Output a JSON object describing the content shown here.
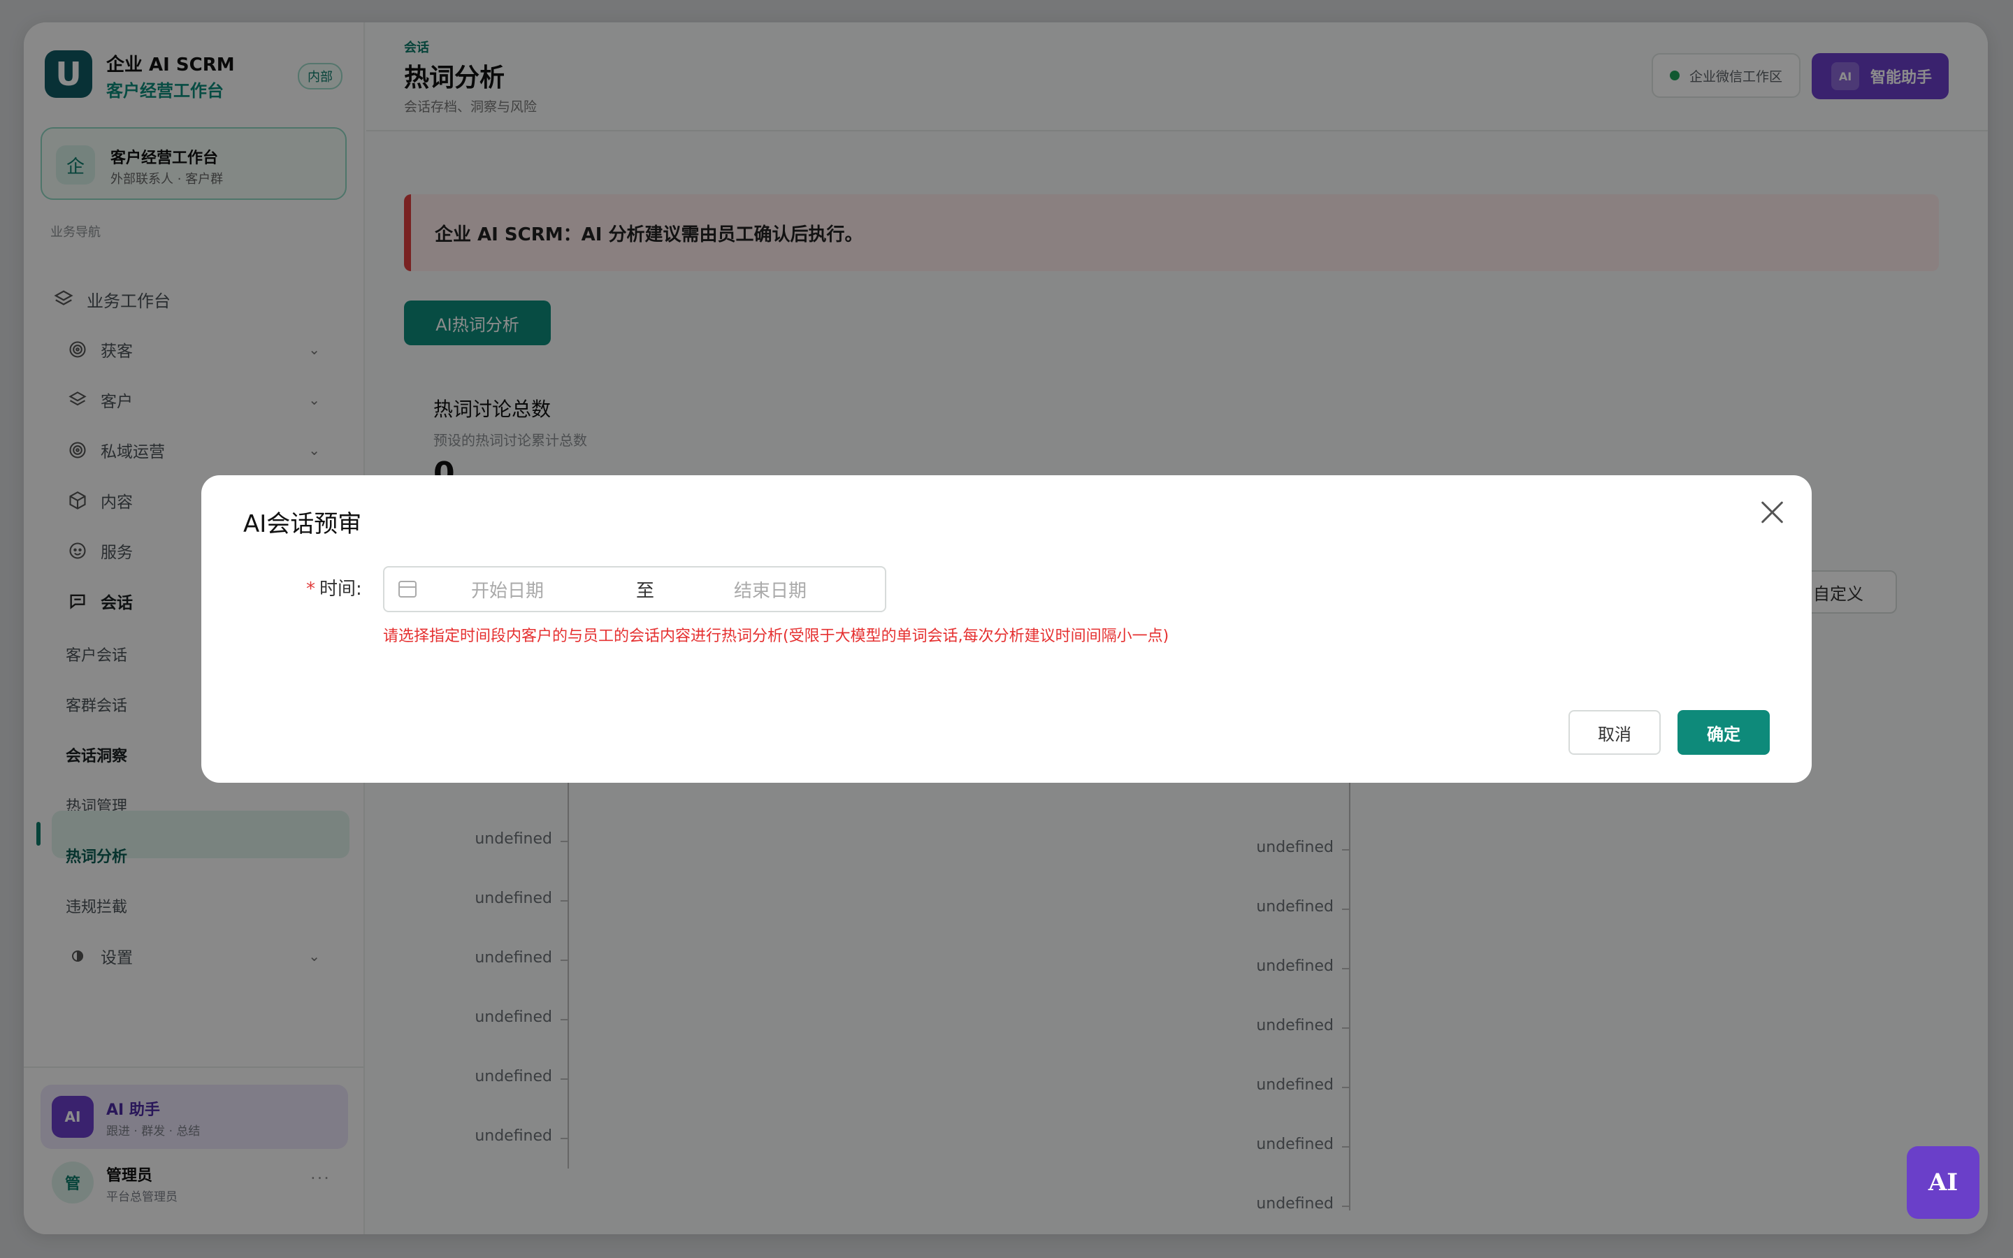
{
  "brand": {
    "logo": "U",
    "title": "企业 AI SCRM",
    "subtitle": "客户经营工作台",
    "badge": "内部"
  },
  "workspace": {
    "icon": "企",
    "title": "客户经营工作台",
    "subtitle": "外部联系人 · 客户群"
  },
  "nav": {
    "section": "业务导航",
    "home": "业务工作台",
    "items": [
      {
        "label": "获客",
        "icon": "target-icon"
      },
      {
        "label": "客户",
        "icon": "layers-icon"
      },
      {
        "label": "私域运营",
        "icon": "target-icon"
      },
      {
        "label": "内容",
        "icon": "box-icon"
      },
      {
        "label": "服务",
        "icon": "face-icon"
      },
      {
        "label": "会话",
        "icon": "chat-icon"
      }
    ],
    "sub_items": [
      "客户会话",
      "客群会话",
      "会话洞察",
      "热词管理",
      "热词分析",
      "违规拦截"
    ],
    "settings": "设置"
  },
  "assistant_card": {
    "avatar": "AI",
    "title": "AI 助手",
    "subtitle": "跟进 · 群发 · 总结"
  },
  "admin": {
    "avatar": "管",
    "name": "管理员",
    "role": "平台总管理员",
    "more": "···"
  },
  "header": {
    "breadcrumb": "会话",
    "title": "热词分析",
    "subtitle": "会话存档、洞察与风险",
    "workspace_badge": "企业微信工作区",
    "assistant_tag": "AI",
    "assistant_label": "智能助手"
  },
  "alert": {
    "text": "企业 AI SCRM：AI 分析建议需由员工确认后执行。"
  },
  "actions": {
    "ai_hot": "AI热词分析",
    "custom": "自定义"
  },
  "stat": {
    "title": "热词讨论总数",
    "subtitle": "预设的热词讨论累计总数",
    "value": "0"
  },
  "chart_ticks_left": [
    "undefined",
    "undefined",
    "undefined",
    "undefined",
    "undefined",
    "undefined"
  ],
  "chart_ticks_right": [
    "undefined",
    "undefined",
    "undefined",
    "undefined",
    "undefined",
    "undefined",
    "undefined"
  ],
  "modal": {
    "title": "AI会话预审",
    "field_label": "时间:",
    "required_mark": "*",
    "start_placeholder": "开始日期",
    "separator": "至",
    "end_placeholder": "结束日期",
    "help": "请选择指定时间段内客户的与员工的会话内容进行热词分析(受限于大模型的单词会话,每次分析建议时间间隔小一点)",
    "cancel": "取消",
    "confirm": "确定"
  },
  "fab": {
    "label": "AI"
  },
  "colors": {
    "accent": "#0e8a7a",
    "purple": "#6a3fc9",
    "danger": "#e53030"
  }
}
